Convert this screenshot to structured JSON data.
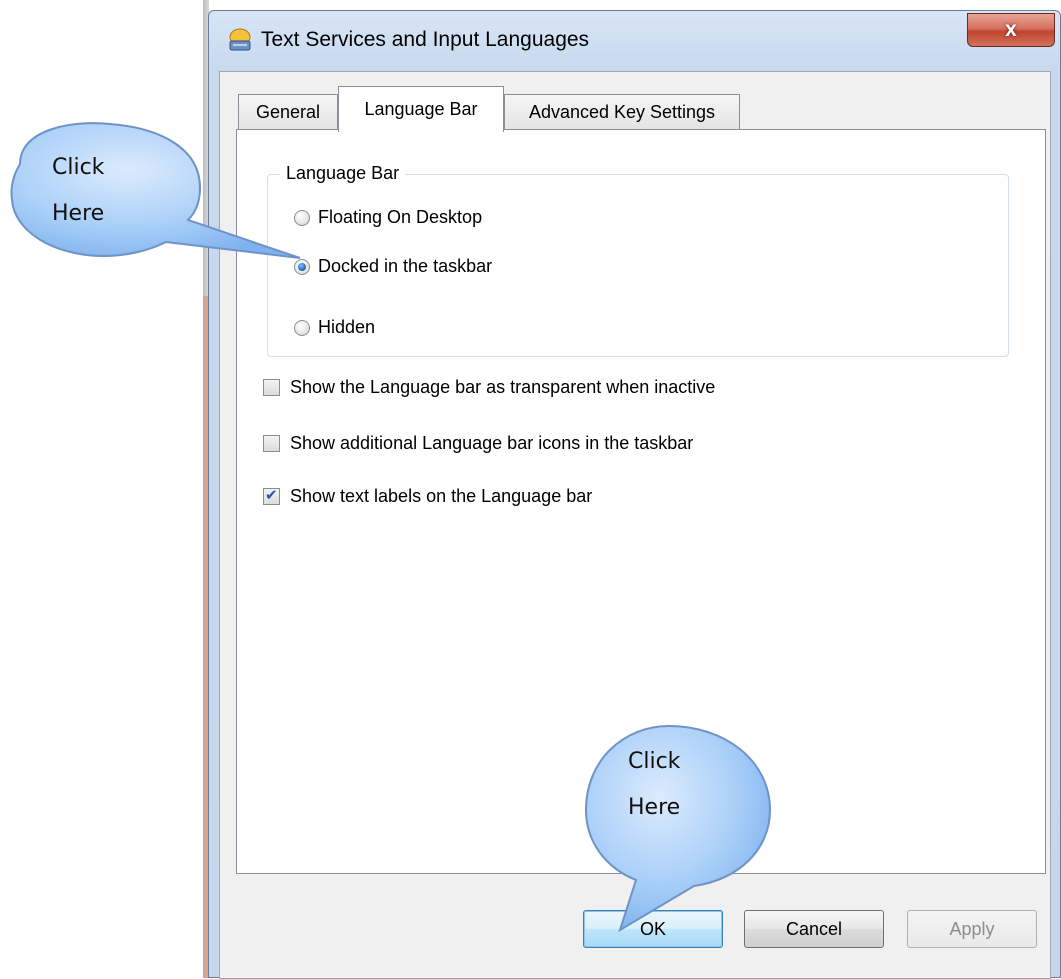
{
  "dialog": {
    "title": "Text Services and Input Languages",
    "close_label": "x"
  },
  "tabs": [
    {
      "label": "General",
      "active": false
    },
    {
      "label": "Language Bar",
      "active": true
    },
    {
      "label": "Advanced Key Settings",
      "active": false
    }
  ],
  "language_bar_group": {
    "legend": "Language Bar",
    "options": [
      {
        "label": "Floating On Desktop",
        "checked": false
      },
      {
        "label": "Docked in the taskbar",
        "checked": true
      },
      {
        "label": "Hidden",
        "checked": false
      }
    ]
  },
  "checkboxes": [
    {
      "label": "Show the Language bar as transparent when inactive",
      "checked": false
    },
    {
      "label": "Show additional Language bar icons in the taskbar",
      "checked": false
    },
    {
      "label": "Show text labels on the Language bar",
      "checked": true
    }
  ],
  "buttons": {
    "ok": "OK",
    "cancel": "Cancel",
    "apply": "Apply"
  },
  "callouts": {
    "first": {
      "line1": "Click",
      "line2": "Here"
    },
    "second": {
      "line1": "Click",
      "line2": "Here"
    }
  },
  "colors": {
    "callout_fill": "#8fc0f5",
    "callout_stroke": "#6f93c6"
  }
}
